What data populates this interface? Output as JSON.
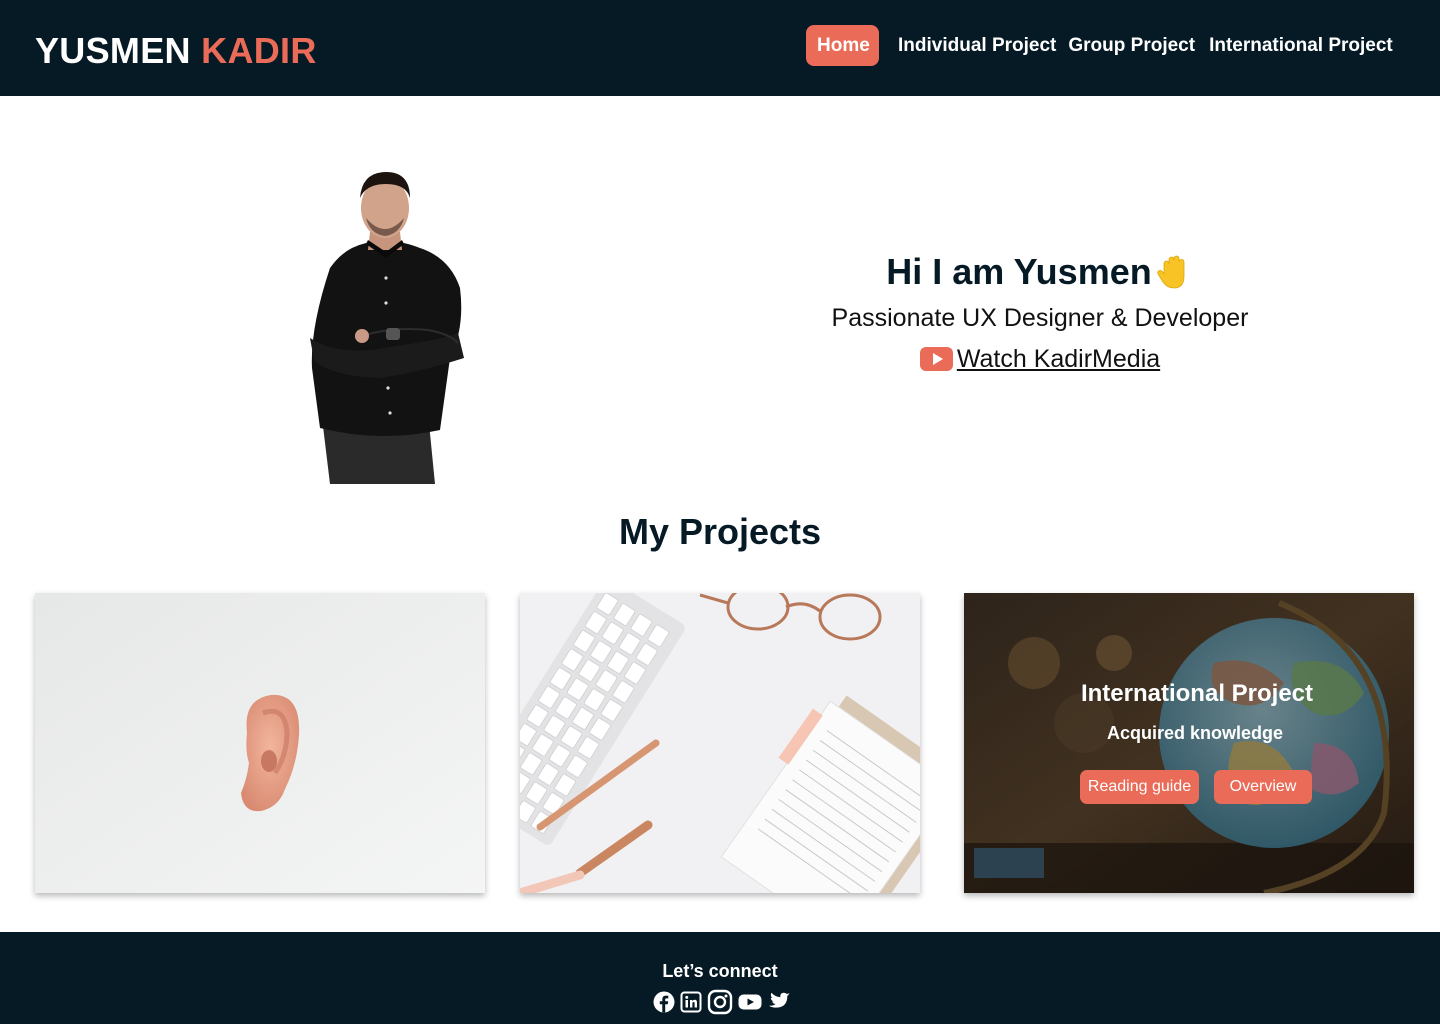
{
  "header": {
    "logo_first": "YUSMEN",
    "logo_last": "KADIR",
    "nav": [
      {
        "label": "Home",
        "active": true
      },
      {
        "label": "Individual Project",
        "active": false
      },
      {
        "label": "Group Project",
        "active": false
      },
      {
        "label": "International Project",
        "active": false
      }
    ]
  },
  "hero": {
    "greeting": "Hi I am Yusmen",
    "tagline": "Passionate UX Designer & Developer",
    "watch_link": "Watch KadirMedia",
    "hand_icon": "waving-hand-icon",
    "video_icon": "youtube-icon"
  },
  "projects": {
    "heading": "My Projects",
    "cards": [
      {
        "image": "ear-photo"
      },
      {
        "image": "desk-keyboard-photo"
      },
      {
        "image": "globe-photo",
        "title": "International Project",
        "subtitle": "Acquired knowledge",
        "buttons": [
          "Reading guide",
          "Overview"
        ]
      }
    ]
  },
  "footer": {
    "connect": "Let’s connect",
    "social_icons": [
      "facebook-icon",
      "linkedin-icon",
      "instagram-icon",
      "youtube-icon",
      "twitter-icon"
    ]
  },
  "colors": {
    "navy": "#061a26",
    "accent": "#ea6b58",
    "white": "#ffffff"
  }
}
